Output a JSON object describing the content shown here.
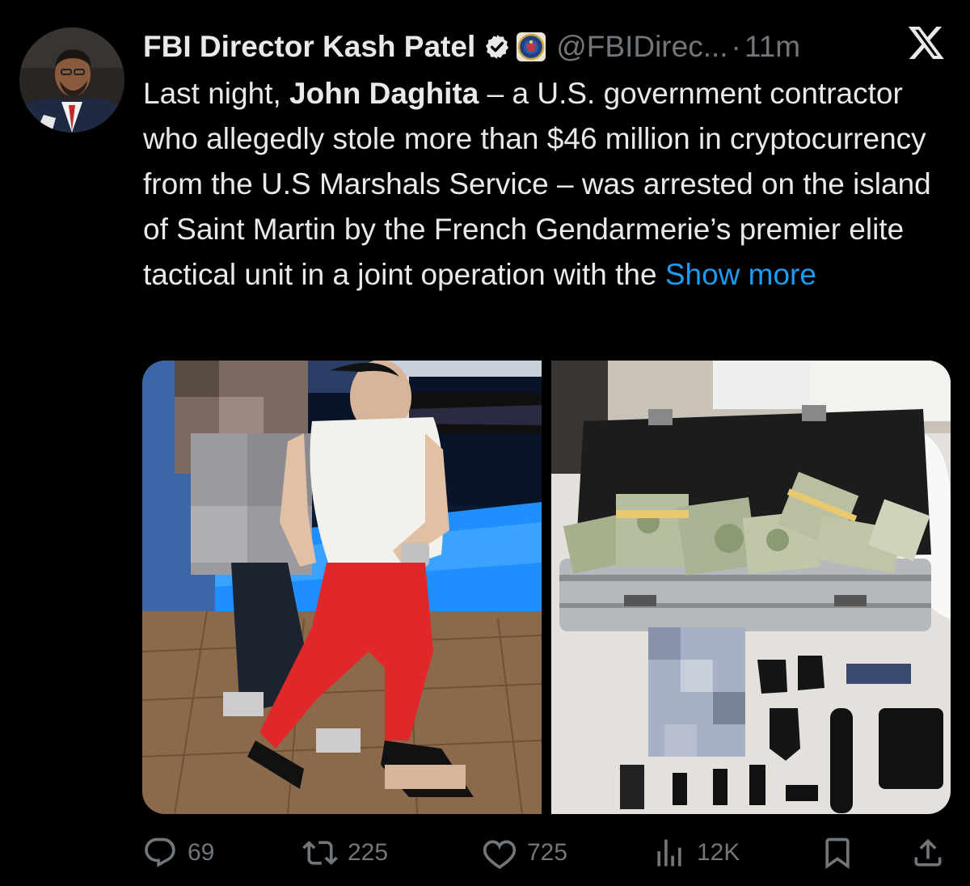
{
  "author": {
    "display_name": "FBI Director Kash Patel",
    "handle": "@FBIDirec...",
    "separator": "·",
    "timestamp": "11m"
  },
  "tweet": {
    "text_before": "Last night, ",
    "bold_name": "John Daghita",
    "text_after": " – a U.S. government contractor who allegedly stole more than $46 million in cryptocurrency from the U.S Marshals Service – was arrested on the island of Saint Martin by the French Gendarmerie’s premier elite tactical unit in a joint operation with the ",
    "show_more": "Show more"
  },
  "actions": {
    "replies": "69",
    "reposts": "225",
    "likes": "725",
    "views": "12K"
  },
  "colors": {
    "background": "#000000",
    "text": "#e7e9ea",
    "muted": "#71767b",
    "link": "#1d9bf0",
    "verified": "#e7e9ea"
  },
  "icons": {
    "verified": "verified-check-icon",
    "affiliation": "fbi-seal-icon",
    "brand": "x-logo-icon",
    "reply": "reply-bubble-icon",
    "repost": "repost-arrows-icon",
    "like": "heart-icon",
    "views": "analytics-bars-icon",
    "bookmark": "bookmark-icon",
    "share": "share-upload-icon"
  }
}
